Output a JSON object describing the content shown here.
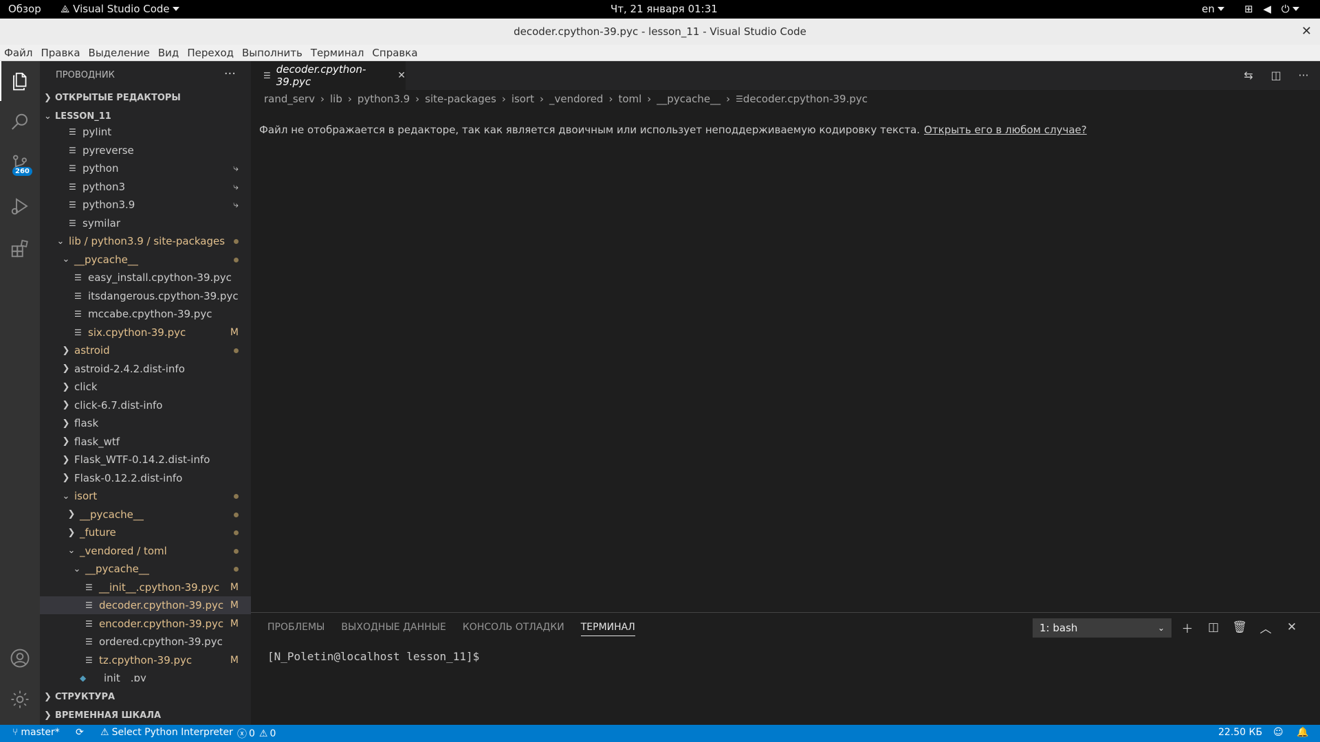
{
  "topbar": {
    "overview": "Обзор",
    "app_name": "Visual Studio Code",
    "datetime": "Чт, 21 января  01:31",
    "lang": "en"
  },
  "window": {
    "title": "decoder.cpython-39.pyc - lesson_11 - Visual Studio Code"
  },
  "menu": [
    "Файл",
    "Правка",
    "Выделение",
    "Вид",
    "Переход",
    "Выполнить",
    "Терминал",
    "Справка"
  ],
  "activity": {
    "scm_badge": "260"
  },
  "sidebar": {
    "title": "ПРОВОДНИК",
    "more": "···",
    "open_editors": "ОТКРЫТЫЕ РЕДАКТОРЫ",
    "workspace": "LESSON_11",
    "outline": "СТРУКТУРА",
    "timeline": "ВРЕМЕННАЯ ШКАЛА",
    "tree": [
      {
        "label": "pylint",
        "kind": "file",
        "depth": 0
      },
      {
        "label": "pyreverse",
        "kind": "file",
        "depth": 0
      },
      {
        "label": "python",
        "kind": "file",
        "depth": 0,
        "link": "⤷"
      },
      {
        "label": "python3",
        "kind": "file",
        "depth": 0,
        "link": "⤷"
      },
      {
        "label": "python3.9",
        "kind": "file",
        "depth": 0,
        "link": "⤷"
      },
      {
        "label": "symilar",
        "kind": "file",
        "depth": 0
      },
      {
        "label": "lib / python3.9 / site-packages",
        "kind": "folder-open",
        "depth": -1,
        "color": "#e2c08d",
        "dot": true
      },
      {
        "label": "__pycache__",
        "kind": "folder-open",
        "depth": 0,
        "color": "#e2c08d",
        "dot": true
      },
      {
        "label": "easy_install.cpython-39.pyc",
        "kind": "file",
        "depth": 1
      },
      {
        "label": "itsdangerous.cpython-39.pyc",
        "kind": "file",
        "depth": 1
      },
      {
        "label": "mccabe.cpython-39.pyc",
        "kind": "file",
        "depth": 1
      },
      {
        "label": "six.cpython-39.pyc",
        "kind": "file",
        "depth": 1,
        "color": "#e2c08d",
        "mark": "M"
      },
      {
        "label": "astroid",
        "kind": "folder",
        "depth": 0,
        "color": "#e2c08d",
        "dot": true
      },
      {
        "label": "astroid-2.4.2.dist-info",
        "kind": "folder",
        "depth": 0
      },
      {
        "label": "click",
        "kind": "folder",
        "depth": 0
      },
      {
        "label": "click-6.7.dist-info",
        "kind": "folder",
        "depth": 0
      },
      {
        "label": "flask",
        "kind": "folder",
        "depth": 0
      },
      {
        "label": "flask_wtf",
        "kind": "folder",
        "depth": 0
      },
      {
        "label": "Flask_WTF-0.14.2.dist-info",
        "kind": "folder",
        "depth": 0
      },
      {
        "label": "Flask-0.12.2.dist-info",
        "kind": "folder",
        "depth": 0
      },
      {
        "label": "isort",
        "kind": "folder-open",
        "depth": 0,
        "color": "#e2c08d",
        "dot": true
      },
      {
        "label": "__pycache__",
        "kind": "folder",
        "depth": 1,
        "color": "#e2c08d",
        "dot": true
      },
      {
        "label": "_future",
        "kind": "folder",
        "depth": 1,
        "color": "#e2c08d",
        "dot": true
      },
      {
        "label": "_vendored / toml",
        "kind": "folder-open",
        "depth": 1,
        "color": "#e2c08d",
        "dot": true
      },
      {
        "label": "__pycache__",
        "kind": "folder-open",
        "depth": 2,
        "color": "#e2c08d",
        "dot": true
      },
      {
        "label": "__init__.cpython-39.pyc",
        "kind": "file",
        "depth": 3,
        "color": "#e2c08d",
        "mark": "M"
      },
      {
        "label": "decoder.cpython-39.pyc",
        "kind": "file",
        "depth": 3,
        "color": "#e2c08d",
        "mark": "M",
        "selected": true
      },
      {
        "label": "encoder.cpython-39.pyc",
        "kind": "file",
        "depth": 3,
        "color": "#e2c08d",
        "mark": "M"
      },
      {
        "label": "ordered.cpython-39.pyc",
        "kind": "file",
        "depth": 3
      },
      {
        "label": "tz.cpython-39.pyc",
        "kind": "file",
        "depth": 3,
        "color": "#e2c08d",
        "mark": "M"
      },
      {
        "label": "__init__.py",
        "kind": "python",
        "depth": 2
      }
    ]
  },
  "editor": {
    "tab_label": "decoder.cpython-39.pyc",
    "breadcrumb": [
      "rand_serv",
      "lib",
      "python3.9",
      "site-packages",
      "isort",
      "_vendored",
      "toml",
      "__pycache__",
      "decoder.cpython-39.pyc"
    ],
    "binary_message": "Файл не отображается в редакторе, так как является двоичным или использует неподдерживаемую кодировку текста.",
    "open_anyway": "Открыть его в любом случае?"
  },
  "panel": {
    "tabs": [
      "ПРОБЛЕМЫ",
      "ВЫХОДНЫЕ ДАННЫЕ",
      "КОНСОЛЬ ОТЛАДКИ",
      "ТЕРМИНАЛ"
    ],
    "active_tab": "ТЕРМИНАЛ",
    "terminal_select": "1: bash",
    "prompt": "[N_Poletin@localhost lesson_11]$"
  },
  "status": {
    "branch": "master*",
    "interpreter": "Select Python Interpreter",
    "errors": "0",
    "warnings": "0",
    "file_size": "22.50 КБ"
  },
  "colors": {
    "accent": "#007acc",
    "modified": "#e2c08d",
    "activity_bg": "#333333",
    "sidebar_bg": "#252526",
    "editor_bg": "#1e1e1e"
  }
}
